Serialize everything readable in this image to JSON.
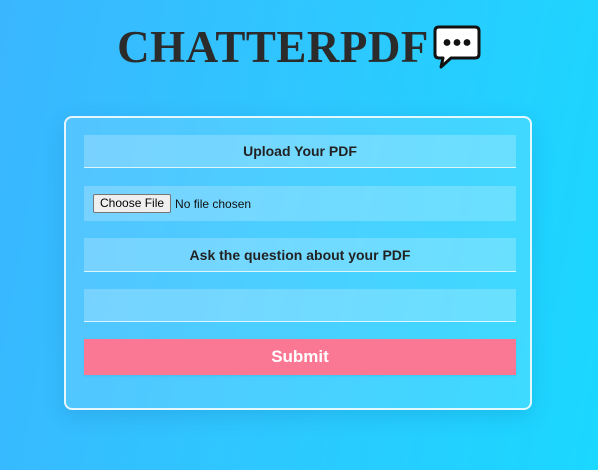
{
  "app": {
    "title": "CHATTERPDF",
    "logo_icon": "speech-bubble-ellipsis-icon"
  },
  "form": {
    "upload_label": "Upload Your PDF",
    "file_button_label": "Choose File",
    "file_status": "No file chosen",
    "question_label": "Ask the question about your PDF",
    "question_value": "",
    "question_placeholder": "",
    "submit_label": "Submit"
  },
  "colors": {
    "background_start": "#3ab6ff",
    "background_end": "#1ad8ff",
    "submit_button": "#fb7894",
    "title_text": "#2b2b2b"
  }
}
